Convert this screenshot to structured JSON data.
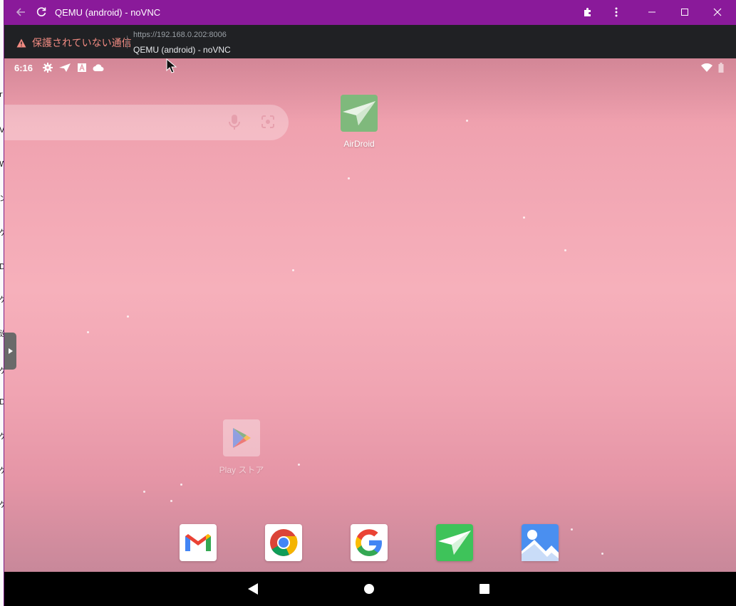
{
  "window": {
    "title": "QEMU (android) - noVNC",
    "url": "https://192.168.0.202:8006",
    "page_title": "QEMU (android) - noVNC",
    "security_warning": "保護されていない通信",
    "accent_color": "#8a1a9a"
  },
  "android": {
    "status_time": "6:16",
    "status_icons": [
      "settings-icon",
      "airdroid-notify-icon",
      "a-icon",
      "cloud-icon"
    ],
    "right_icons": [
      "wifi-icon",
      "battery-icon"
    ],
    "home_apps": [
      {
        "label": "AirDroid",
        "icon": "airdroid-icon"
      },
      {
        "label": "Play ストア",
        "icon": "play-store-icon"
      }
    ],
    "dock_apps": [
      "gmail-icon",
      "chrome-icon",
      "google-icon",
      "airdroid-icon",
      "gallery-icon"
    ],
    "nav_buttons": [
      "back-icon",
      "home-icon",
      "recents-icon"
    ]
  },
  "left_strip_glyphs": [
    "r",
    "V",
    "W",
    "ン",
    "ゲ",
    "D",
    "ゲ",
    "设",
    "ゲ",
    "D",
    "ゲ",
    "ゲ",
    "ゲ"
  ]
}
